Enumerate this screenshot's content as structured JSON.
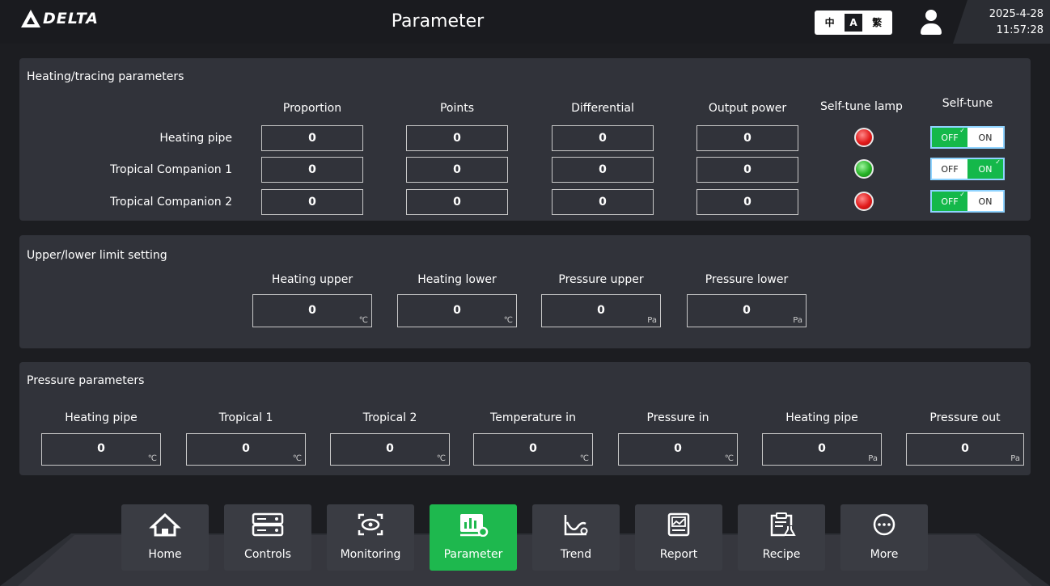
{
  "header": {
    "logo_text": "DELTA",
    "title": "Parameter",
    "languages": [
      "中",
      "A",
      "繁"
    ],
    "active_language": "A",
    "date": "2025-4-28",
    "time": "11:57:28"
  },
  "heating": {
    "title": "Heating/tracing parameters",
    "columns": [
      "Proportion",
      "Points",
      "Differential",
      "Output power",
      "Self-tune lamp",
      "Self-tune"
    ],
    "rows": [
      {
        "label": "Heating pipe",
        "values": [
          "0",
          "0",
          "0",
          "0"
        ],
        "lamp": "red",
        "self_tune": "OFF"
      },
      {
        "label": "Tropical Companion 1",
        "values": [
          "0",
          "0",
          "0",
          "0"
        ],
        "lamp": "green",
        "self_tune": "ON"
      },
      {
        "label": "Tropical Companion 2",
        "values": [
          "0",
          "0",
          "0",
          "0"
        ],
        "lamp": "red",
        "self_tune": "OFF"
      }
    ],
    "toggle_off": "OFF",
    "toggle_on": "ON"
  },
  "limits": {
    "title": "Upper/lower limit setting",
    "items": [
      {
        "label": "Heating upper",
        "value": "0",
        "unit": "℃"
      },
      {
        "label": "Heating lower",
        "value": "0",
        "unit": "℃"
      },
      {
        "label": "Pressure upper",
        "value": "0",
        "unit": "Pa"
      },
      {
        "label": "Pressure lower",
        "value": "0",
        "unit": "Pa"
      }
    ]
  },
  "pressure": {
    "title": "Pressure parameters",
    "items": [
      {
        "label": "Heating pipe",
        "value": "0",
        "unit": "℃"
      },
      {
        "label": "Tropical 1",
        "value": "0",
        "unit": "℃"
      },
      {
        "label": "Tropical 2",
        "value": "0",
        "unit": "℃"
      },
      {
        "label": "Temperature in",
        "value": "0",
        "unit": "℃"
      },
      {
        "label": "Pressure in",
        "value": "0",
        "unit": "℃"
      },
      {
        "label": "Heating pipe",
        "value": "0",
        "unit": "Pa"
      },
      {
        "label": "Pressure out",
        "value": "0",
        "unit": "Pa"
      }
    ]
  },
  "nav": {
    "items": [
      {
        "label": "Home",
        "icon": "home-icon"
      },
      {
        "label": "Controls",
        "icon": "controls-icon"
      },
      {
        "label": "Monitoring",
        "icon": "monitoring-icon"
      },
      {
        "label": "Parameter",
        "icon": "parameter-icon"
      },
      {
        "label": "Trend",
        "icon": "trend-icon"
      },
      {
        "label": "Report",
        "icon": "report-icon"
      },
      {
        "label": "Recipe",
        "icon": "recipe-icon"
      },
      {
        "label": "More",
        "icon": "more-icon"
      }
    ],
    "active": "Parameter"
  },
  "colors": {
    "accent_green": "#1eb84e",
    "lamp_red": "#e21b1b",
    "lamp_green": "#27b327",
    "panel": "#31333a",
    "background": "#1c1d21"
  }
}
